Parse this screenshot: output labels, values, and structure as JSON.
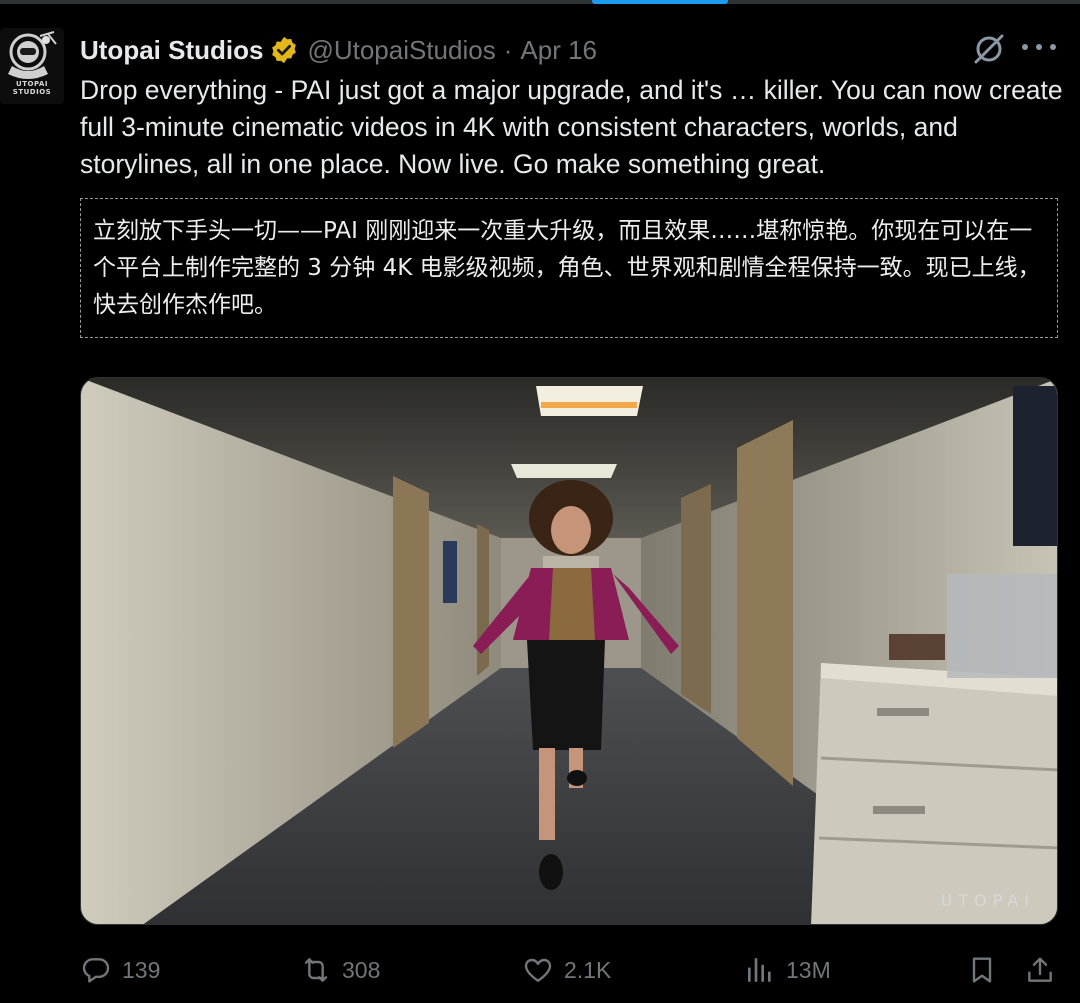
{
  "author": {
    "display_name": "Utopai Studios",
    "handle": "@UtopaiStudios",
    "separator": "·",
    "date": "Apr 16",
    "avatar_text": "UTOPAI\nSTUDIOS",
    "verified": true
  },
  "icons": {
    "verified": "verified-badge-icon",
    "grok": "grok-icon",
    "more": "more-icon",
    "reply": "reply-icon",
    "repost": "repost-icon",
    "like": "heart-icon",
    "views": "views-icon",
    "bookmark": "bookmark-icon",
    "share": "share-icon"
  },
  "tweet": {
    "text": "Drop everything - PAI just got a major upgrade, and it's … killer. You can now create full 3-minute cinematic videos in 4K with consistent characters, worlds, and storylines, all in one place. Now live. Go make something great."
  },
  "translation": {
    "text": "立刻放下手头一切——PAI 刚刚迎来一次重大升级，而且效果……堪称惊艳。你现在可以在一个平台上制作完整的 3 分钟 4K 电影级视频，角色、世界观和剧情全程保持一致。现已上线，快去创作杰作吧。"
  },
  "media": {
    "watermark": "UTOPAI"
  },
  "actions": {
    "replies": "139",
    "reposts": "308",
    "likes": "2.1K",
    "views": "13M"
  },
  "colors": {
    "background": "#000000",
    "text": "#e7e9ea",
    "secondary": "#71767b",
    "verified_gold": "#e2b719",
    "accent": "#1d9bf0"
  }
}
